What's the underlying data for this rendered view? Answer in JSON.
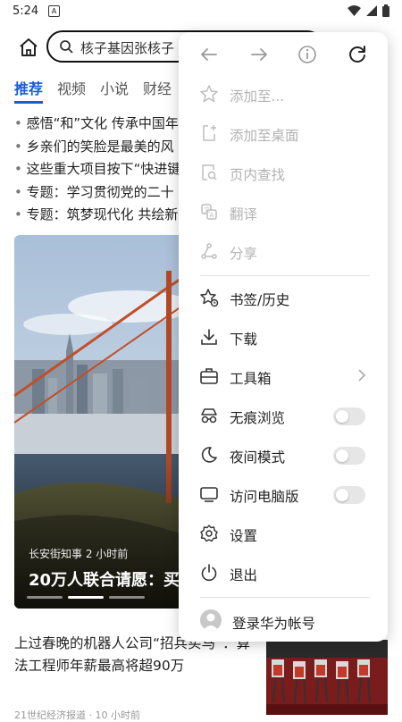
{
  "status_bar": {
    "time": "5:24",
    "app_icon_letter": "A"
  },
  "search": {
    "query": "核子基因张核子"
  },
  "tabs": [
    {
      "label": "推荐",
      "active": true
    },
    {
      "label": "视频",
      "active": false
    },
    {
      "label": "小说",
      "active": false
    },
    {
      "label": "财经",
      "active": false
    }
  ],
  "news_list": [
    "感悟“和”文化 传承中国年",
    "乡亲们的笑脸是最美的风",
    "这些重大项目按下“快进键",
    "专题：学习贯彻党的二十",
    "专题：筑梦现代化 共绘新"
  ],
  "hero": {
    "source": "长安街知事",
    "time_ago": "2 小时前",
    "headline": "20万人联合请愿：买"
  },
  "article2": {
    "title": "上过春晚的机器人公司“招兵买马”：算法工程师年薪最高将超90万",
    "source": "21世纪经济报道 · 10 小时前"
  },
  "menu": {
    "disabled_items": [
      {
        "label": "添加至...",
        "icon": "star-add-icon"
      },
      {
        "label": "添加至桌面",
        "icon": "add-to-desktop-icon"
      },
      {
        "label": "页内查找",
        "icon": "find-in-page-icon"
      },
      {
        "label": "翻译",
        "icon": "translate-icon"
      },
      {
        "label": "分享",
        "icon": "share-icon"
      }
    ],
    "items": [
      {
        "label": "书签/历史",
        "icon": "bookmark-history-icon"
      },
      {
        "label": "下载",
        "icon": "download-icon"
      },
      {
        "label": "工具箱",
        "icon": "toolbox-icon"
      },
      {
        "label": "无痕浏览",
        "icon": "incognito-icon",
        "toggle": false
      },
      {
        "label": "夜间模式",
        "icon": "moon-icon",
        "toggle": false
      },
      {
        "label": "访问电脑版",
        "icon": "desktop-icon",
        "toggle": false
      },
      {
        "label": "设置",
        "icon": "gear-icon"
      },
      {
        "label": "退出",
        "icon": "power-icon"
      }
    ],
    "login_label": "登录华为帐号"
  },
  "colors": {
    "accent": "#1a5bd6",
    "disabled": "#b3b3b3"
  }
}
